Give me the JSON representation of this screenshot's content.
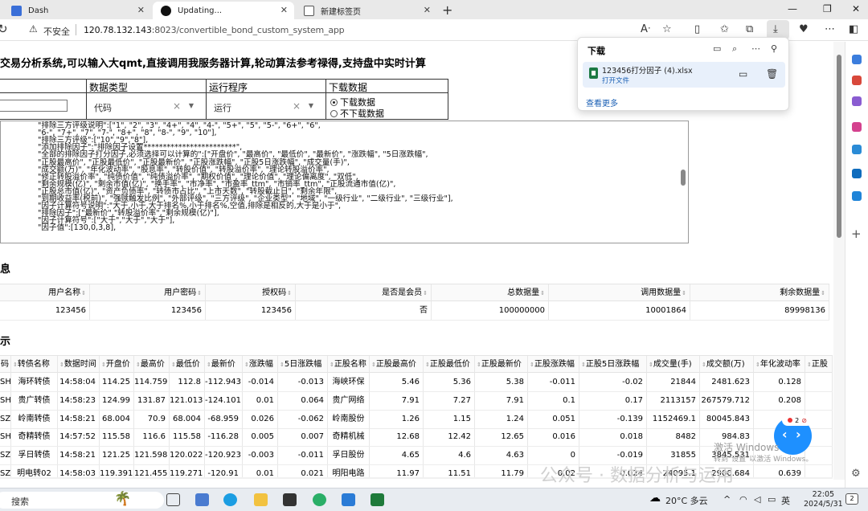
{
  "browser": {
    "tabs": [
      {
        "label": "Dash"
      },
      {
        "label": "Updating..."
      },
      {
        "label": "新建标签页"
      }
    ],
    "security": "不安全",
    "url_host": "120.78.132.143",
    "url_path": ":8023/convertible_bond_custom_system_app"
  },
  "downloads": {
    "title": "下载",
    "file_name": "123456打分因子 (4).xlsx",
    "open_file": "打开文件",
    "see_more": "查看更多"
  },
  "page": {
    "title": "交易分析系统,可以输入大qmt,直接调用我服务器计算,轮动算法参考禄得,支持盘中实时计算",
    "controls": {
      "col_data_type": "数据类型",
      "col_program": "运行程序",
      "col_download": "下载数据",
      "data_type_value": "代码",
      "program_value": "运行",
      "radio_download": "下载数据",
      "radio_no_download": "不下载数据"
    },
    "code_lines": [
      "\"排除三方评级说明\":[\"1\", \"2\", \"3\", \"4+\", \"4\", \"4-\", \"5+\", \"5\", \"5-\", \"6+\", \"6\",",
      "\"6-\", \"7+\", \"7\", \"7-\", \"8+\", \"8\", \"8-\", \"9\", \"10\"],",
      "\"排除三方评级\":[\"10\",\"9\",\"8\"],",
      "\"添加排除因子\":\"排除因子设置************************\",",
      "\"全部的排除因子打分因子,必须选择可以计算的\":[\"开盘价\", \"最高价\", \"最低价\", \"最新价\", \"涨跌幅\", \"5日涨跌幅\",",
      "\"正股最高价\", \"正股最低价\", \"正股最新价\", \"正股涨跌幅\", \"正股5日涨跌幅\", \"成交量(手)\",",
      "\"成交额(万)\", \"年化波动率\", \"股息率\", \"转股价值\", \"转股溢价率\", \"理论转股溢价率\",",
      "\"修正转股溢价率\", \"纯债价值\", \"纯债溢价率\", \"期权价值\", \"理论价值\", \"理论偏离度\", \"双低\",",
      "\"剩余规模(亿)\", \"剩余市值(亿)\", \"换手率\", \"市净率\", \"市盈率_ttm\", \"市销率_ttm\", \"正股流通市值(亿)\",",
      "\"正股总市值(亿)\", \"资产负债率\", \"转债市占比\", \"上市天数\", \"转股截止日\", \"剩余年限\",",
      "\"到期收益率(税前)\", \"强赎触发比例\", \"外部评级\", \"三方评级\", \"企业类型\", \"地域\", \"一级行业\", \"二级行业\", \"三级行业\"],",
      "\"因子计算符号说明\":\"大于,小于,大于排名%,小于排名%,空值,排除是相反的,大于是小于\",",
      "\"排除因子\":[\"最新价\",\"转股溢价率\",\"剩余规模(亿)\"],",
      "\"因子计算符号\":[\"大于\",\"大于\",\"大于\"],",
      "\"因子值\":[130,0,3,8],"
    ],
    "section_account": "息",
    "account_headers": [
      "用户名称",
      "用户密码",
      "授权码",
      "是否是会员",
      "总数据量",
      "调用数据量",
      "剩余数据量"
    ],
    "account_row": [
      "123456",
      "123456",
      "123456",
      "否",
      "100000000",
      "10001864",
      "89998136"
    ],
    "section_data": "示",
    "data_headers": [
      "码",
      "转债名称",
      "数据时间",
      "开盘价",
      "最高价",
      "最低价",
      "最新价",
      "涨跌幅",
      "5日涨跌幅",
      "正股名称",
      "正股最高价",
      "正股最低价",
      "正股最新价",
      "正股涨跌幅",
      "正股5日涨跌幅",
      "成交量(手)",
      "成交额(万)",
      "年化波动率",
      "正股"
    ],
    "data_rows": [
      [
        "SH",
        "海环转债",
        "14:58:04",
        "114.25",
        "114.759",
        "112.8",
        "-112.943",
        "-0.014",
        "-0.013",
        "海峡环保",
        "5.46",
        "5.36",
        "5.38",
        "-0.011",
        "-0.02",
        "21844",
        "2481.623",
        "0.128",
        ""
      ],
      [
        "SH",
        "贵广转债",
        "14:58:23",
        "124.99",
        "131.87",
        "121.013",
        "-124.101",
        "0.01",
        "0.064",
        "贵广网络",
        "7.91",
        "7.27",
        "7.91",
        "0.1",
        "0.17",
        "2113157",
        "267579.712",
        "0.208",
        ""
      ],
      [
        "SZ",
        "岭南转债",
        "14:58:21",
        "68.004",
        "70.9",
        "68.004",
        "-68.959",
        "0.026",
        "-0.062",
        "岭南股份",
        "1.26",
        "1.15",
        "1.24",
        "0.051",
        "-0.139",
        "1152469.1",
        "80045.843",
        "",
        ""
      ],
      [
        "SH",
        "奇精转债",
        "14:57:52",
        "115.58",
        "116.6",
        "115.58",
        "-116.28",
        "0.005",
        "0.007",
        "奇精机械",
        "12.68",
        "12.42",
        "12.65",
        "0.016",
        "0.018",
        "8482",
        "984.83",
        "",
        ""
      ],
      [
        "SZ",
        "孚日转债",
        "14:58:21",
        "121.25",
        "121.598",
        "120.022",
        "-120.923",
        "-0.003",
        "-0.011",
        "孚日股份",
        "4.65",
        "4.6",
        "4.63",
        "0",
        "-0.019",
        "31855",
        "3845.531",
        "",
        ""
      ],
      [
        "SZ",
        "明电转02",
        "14:58:03",
        "119.391",
        "121.455",
        "119.271",
        "-120.91",
        "0.01",
        "0.021",
        "明阳电路",
        "11.97",
        "11.51",
        "11.79",
        "0.02",
        "0.024",
        "24095.1",
        "2900.684",
        "0.639",
        ""
      ]
    ]
  },
  "overlay": {
    "badge_count": "2",
    "activate_title": "激活 Windows",
    "activate_sub": "转到\"设置\"以激活 Windows。",
    "watermark": "公众号 · 数据分析与运用"
  },
  "taskbar": {
    "search": "搜索",
    "weather": "20°C 多云",
    "lang": "英",
    "time": "22:05",
    "date": "2024/5/31",
    "notif": "2"
  },
  "colors": {
    "accent": "#1a5fb4",
    "float_button": "#1e90ff"
  }
}
